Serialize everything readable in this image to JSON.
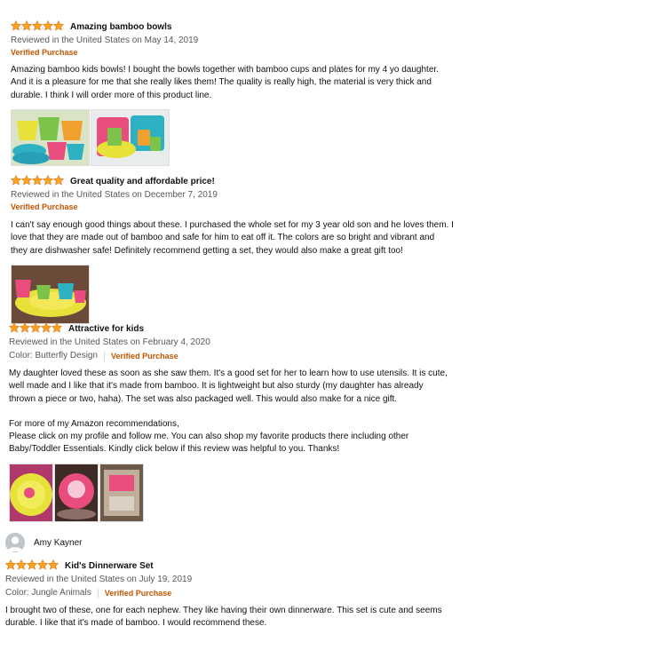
{
  "reviews": [
    {
      "title": "Amazing bamboo bowls",
      "meta": "Reviewed in the United States on May 14, 2019",
      "verified": "Verified Purchase",
      "rating": 5,
      "body": [
        "Amazing bamboo kids bowls! I bought the bowls together with bamboo cups and plates for my 4 yo daughter.",
        "And it is a pleasure for me that she really likes them! The quality is really high, the material is very thick and",
        "durable. I think I will order more of this product line."
      ]
    },
    {
      "title": "Great quality and affordable price!",
      "meta": "Reviewed in the United States on December 7, 2019",
      "verified": "Verified Purchase",
      "rating": 5,
      "body": [
        "I can't say enough good things about these. I purchased the whole set for my 3 year old son and he loves them. I",
        "love that they are made out of bamboo and safe for him to eat off it. The colors are so bright and vibrant and",
        "they are dishwasher safe! Definitely recommend getting a set, they would also make a great gift too!"
      ]
    },
    {
      "title": "Attractive for kids",
      "meta": "Reviewed in the United States on February 4, 2020",
      "color": "Color: Butterfly Design",
      "verified": "Verified Purchase",
      "rating": 5,
      "body": [
        "My daughter loved these as soon as she saw them. It's a good set for her to learn how to use utensils. It is cute,",
        "well made and I like that it's made from bamboo. It is lightweight but also sturdy (my daughter has already",
        "thrown a piece or two, haha). The set was also packaged well. This would also make for a nice gift."
      ],
      "body2": [
        "For more of my Amazon recommendations,",
        "Please click on my profile and follow me. You can also shop my favorite products there including other",
        "Baby/Toddler Essentials. Kindly click below if this review was helpful to you. Thanks!"
      ]
    },
    {
      "reviewer": "Amy Kayner",
      "title": "Kid's Dinnerware Set",
      "meta": "Reviewed in the United States on July 19, 2019",
      "color": "Color: Jungle Animals",
      "verified": "Verified Purchase",
      "rating": 5,
      "body": [
        "I brought two of these, one for each nephew. They like having their own dinnerware. This set is cute and seems",
        "durable. I like that it's made of bamboo. I would recommend these."
      ]
    }
  ],
  "colors": {
    "star": "#ffa41c",
    "star_edge": "#de7921",
    "verified": "#c45500",
    "meta": "#565959"
  },
  "icons": {
    "star": "star-icon",
    "avatar": "default-avatar-icon"
  }
}
